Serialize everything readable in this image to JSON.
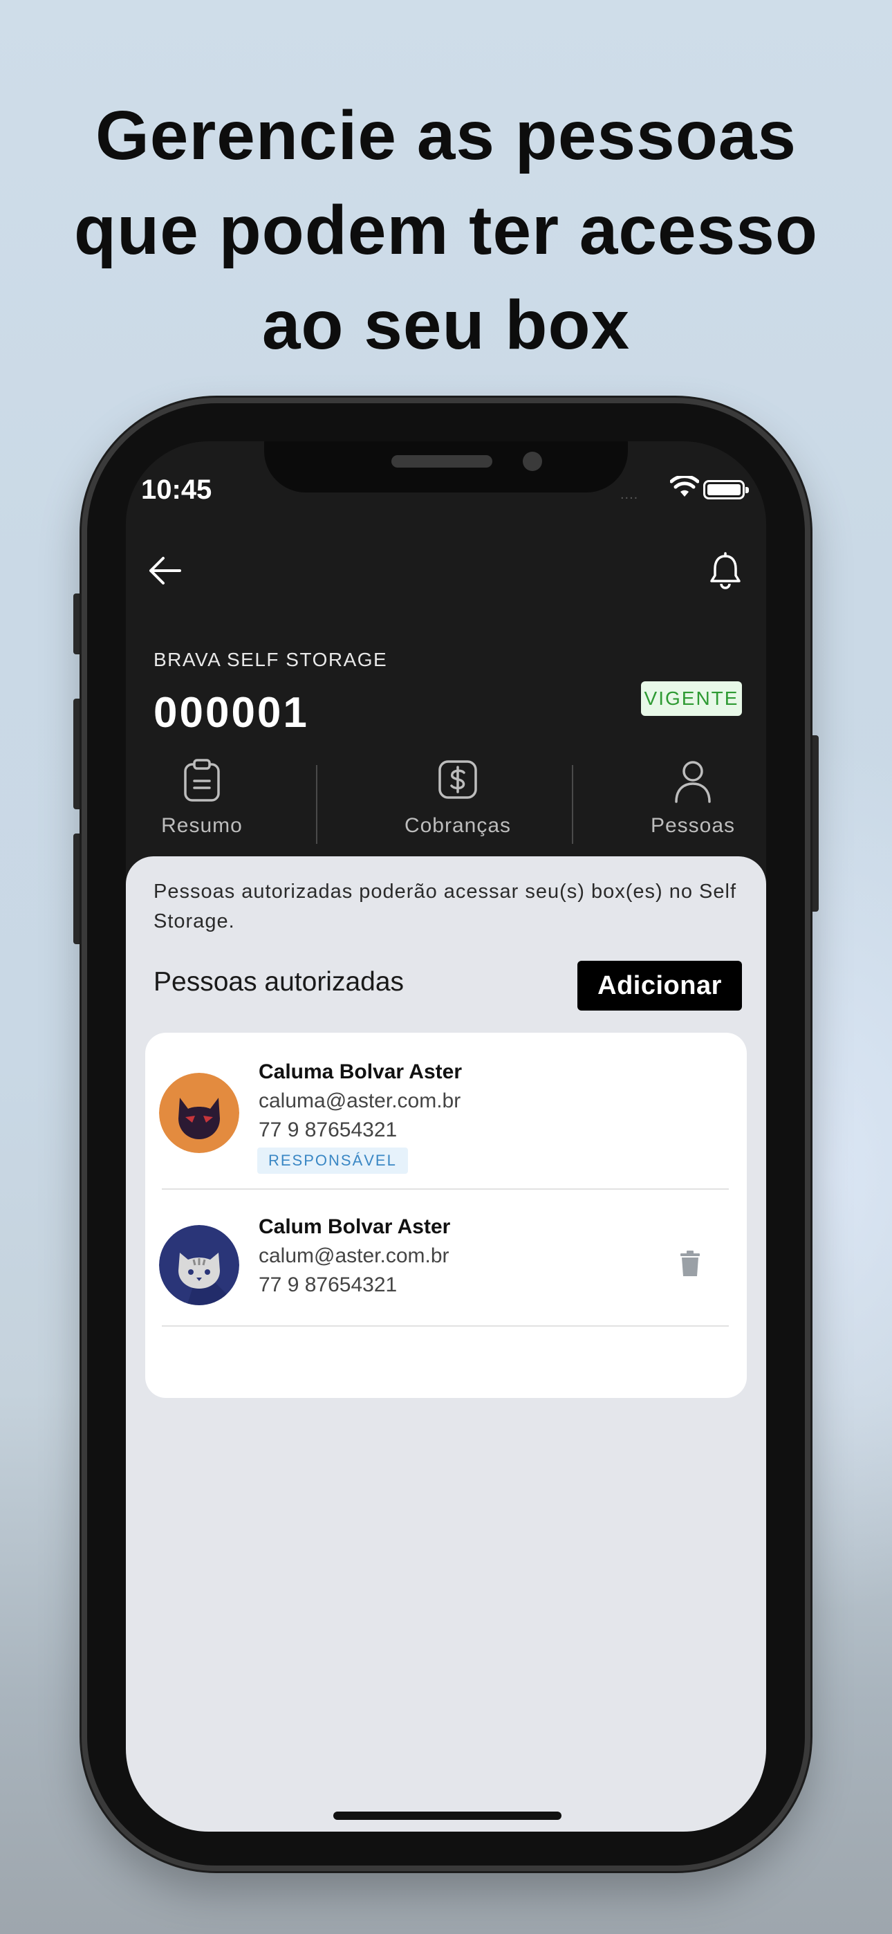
{
  "headline": {
    "line1": "Gerencie as pessoas",
    "line2": "que podem ter acesso",
    "line3": "ao seu box"
  },
  "status_bar": {
    "time": "10:45",
    "signal": "....",
    "icons": [
      "wifi-icon",
      "battery-icon"
    ]
  },
  "header": {
    "back_icon": "arrow-left-icon",
    "notification_icon": "bell-icon",
    "company": "BRAVA SELF STORAGE",
    "contract_id": "000001",
    "status_badge": "VIGENTE",
    "status_color": "#2e9a33"
  },
  "tabs": [
    {
      "label": "Resumo",
      "icon": "clipboard-icon"
    },
    {
      "label": "Cobranças",
      "icon": "dollar-icon"
    },
    {
      "label": "Pessoas",
      "icon": "person-icon"
    }
  ],
  "content": {
    "info": "Pessoas autorizadas poderão acessar seu(s) box(es) no Self Storage.",
    "section_title": "Pessoas autorizadas",
    "add_button": "Adicionar",
    "people": [
      {
        "name": "Caluma Bolvar Aster",
        "email": "caluma@aster.com.br",
        "phone": "77 9 87654321",
        "badge": "RESPONSÁVEL",
        "avatar": "black-cat-mask-avatar",
        "avatar_color": "#e38b3f"
      },
      {
        "name": "Calum Bolvar Aster",
        "email": "calum@aster.com.br",
        "phone": "77 9 87654321",
        "avatar": "gray-cat-avatar",
        "avatar_color": "#2a3578",
        "action_icon": "trash-icon"
      }
    ]
  },
  "colors": {
    "app_header_bg": "#1b1b1b",
    "content_bg": "#e4e6eb",
    "accent_button": "#000000",
    "badge_blue": "#3a87c4"
  }
}
